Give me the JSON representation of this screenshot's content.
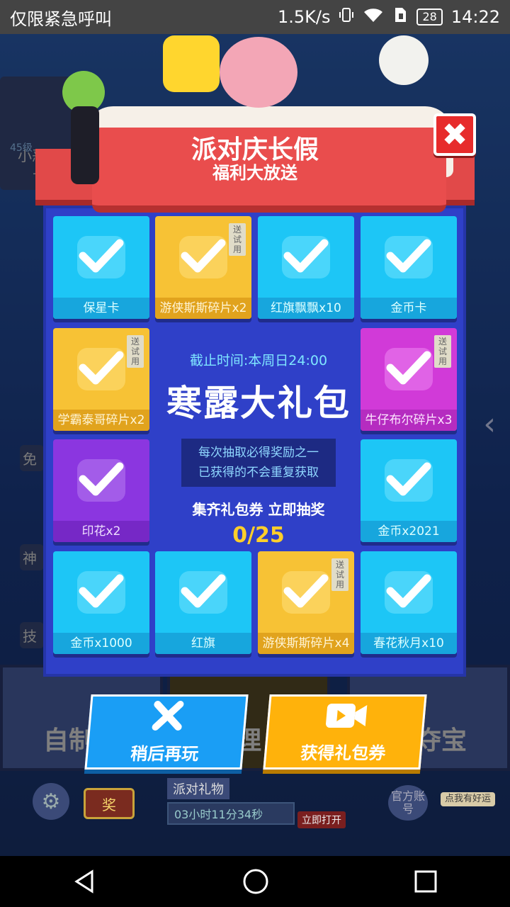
{
  "status_bar": {
    "carrier": "仅限紧急呼叫",
    "speed": "1.5K/s",
    "battery": "28",
    "time": "14:22"
  },
  "background": {
    "player_name": "小恶龙",
    "player_sub": "十",
    "level": "45级",
    "side_items": [
      "免",
      "神",
      "技"
    ],
    "tile_left": "自制地",
    "tile_mid": "理",
    "tile_right": "日夺宝",
    "prize_label": "奖",
    "party_gift_title": "派对礼物",
    "party_gift_timer": "03小时11分34秒",
    "open_now": "立即打开",
    "official_account": "官方账号",
    "luck_badge": "点我有好运"
  },
  "popup": {
    "title": "派对庆长假",
    "subtitle": "福利大放送",
    "deadline": "截止时间:本周日24:00",
    "big_title": "寒露大礼包",
    "rules_line1": "每次抽取必得奖励之一",
    "rules_line2": "已获得的不会重复获取",
    "collect_text": "集齐礼包券 立即抽奖",
    "progress": "0/25",
    "trial_tag": "送试用",
    "cards": [
      {
        "label": "保星卡",
        "color": "cyan",
        "icon": "shield-card-icon",
        "trial": false
      },
      {
        "label": "游侠斯斯碎片x2",
        "color": "yellow",
        "icon": "moose-character-icon",
        "trial": true
      },
      {
        "label": "红旗飘飘x10",
        "color": "cyan",
        "icon": "red-flag-banner-icon",
        "trial": false
      },
      {
        "label": "金币卡",
        "color": "cyan",
        "icon": "coin-card-icon",
        "trial": false
      },
      {
        "label": "学霸泰哥碎片x2",
        "color": "yellow",
        "icon": "tiger-character-icon",
        "trial": true
      },
      {
        "label": "牛仔布尔碎片x3",
        "color": "pink",
        "icon": "bull-character-icon",
        "trial": true
      },
      {
        "label": "印花x2",
        "color": "purple",
        "icon": "stamp-icon",
        "trial": false
      },
      {
        "label": "金币x2021",
        "color": "cyan",
        "icon": "coin-icon",
        "trial": false
      },
      {
        "label": "金币x1000",
        "color": "cyan",
        "icon": "coin-icon",
        "trial": false
      },
      {
        "label": "红旗",
        "color": "cyan",
        "icon": "flag-icon",
        "trial": false
      },
      {
        "label": "游侠斯斯碎片x4",
        "color": "yellow",
        "icon": "cactus-character-icon",
        "trial": true
      },
      {
        "label": "春花秋月x10",
        "color": "cyan",
        "icon": "spring-flower-banner-icon",
        "trial": false
      }
    ]
  },
  "buttons": {
    "later": "稍后再玩",
    "get_voucher": "获得礼包券"
  },
  "colors": {
    "cyan_card": "#1dc6f6",
    "yellow_card": "#f7c235",
    "pink_card": "#d13ad8",
    "purple_card": "#8b36e0",
    "popup_bg": "#2f40c8",
    "ribbon_red": "#e14949",
    "progress_yellow": "#ffcf2a"
  }
}
